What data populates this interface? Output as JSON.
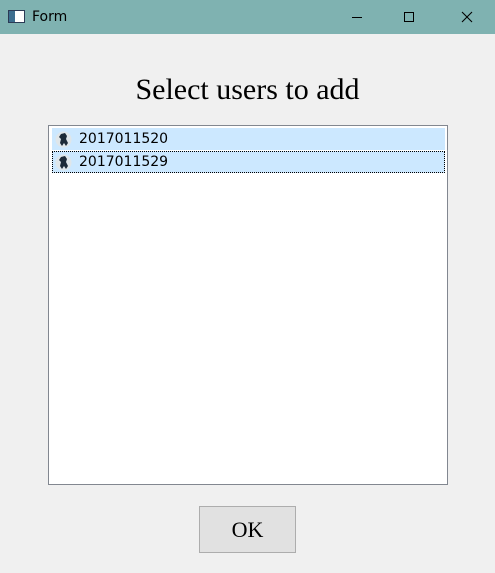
{
  "window": {
    "title": "Form",
    "controls": {
      "minimize_icon": "minimize-icon",
      "maximize_icon": "maximize-icon",
      "close_icon": "close-icon"
    }
  },
  "heading": "Select users to add",
  "users": [
    {
      "label": "2017011520",
      "icon": "user-avatar-icon",
      "selected": true,
      "focused": false
    },
    {
      "label": "2017011529",
      "icon": "user-avatar-icon",
      "selected": true,
      "focused": true
    }
  ],
  "ok_label": "OK",
  "colors": {
    "titlebar": "#7fb2b1",
    "selection": "#cce8ff",
    "window_bg": "#f0f0f0"
  }
}
